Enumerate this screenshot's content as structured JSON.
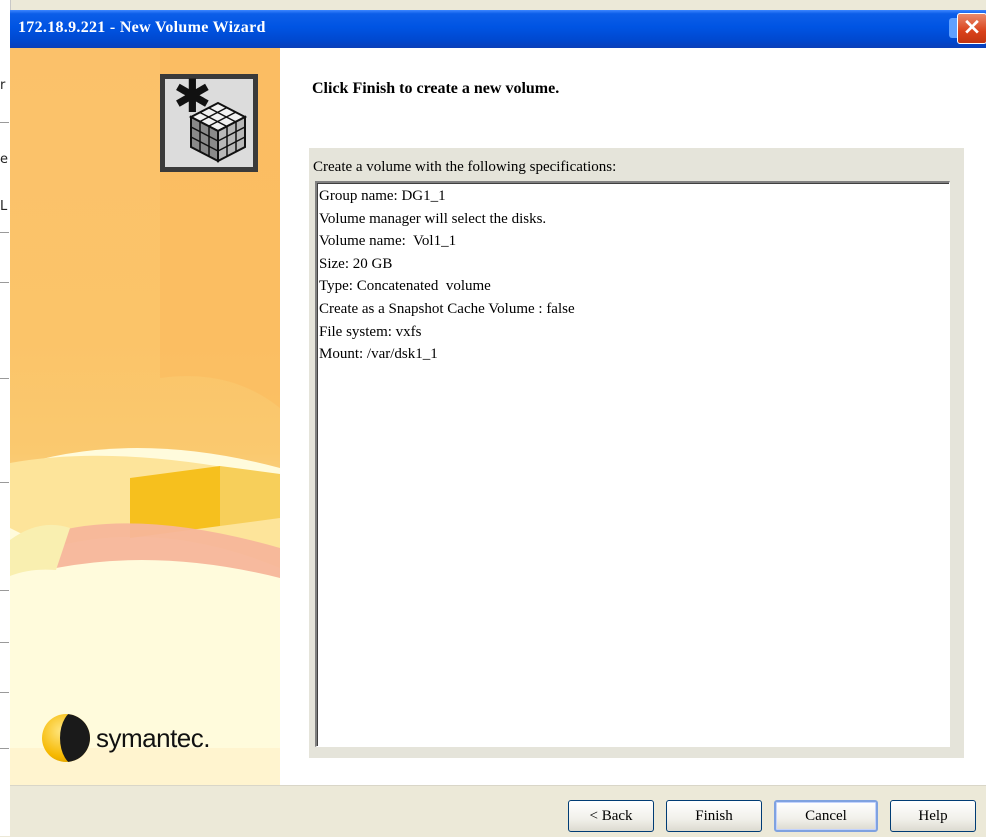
{
  "window": {
    "title": "172.18.9.221 - New Volume Wizard",
    "close_glyph": "×"
  },
  "left_edge_glyphs": [
    "r",
    "e",
    "L"
  ],
  "sidebar": {
    "icon": "new-volume-wizard-icon",
    "logo_text": "symantec."
  },
  "content": {
    "headline": "Click Finish to create a new volume.",
    "spec_caption": "Create a volume with the following specifications:",
    "spec_lines": [
      "Group name: DG1_1",
      "Volume manager will select the disks.",
      "Volume name:  Vol1_1",
      "Size: 20 GB",
      "Type: Concatenated  volume",
      "Create as a Snapshot Cache Volume : false",
      "File system: vxfs",
      "Mount: /var/dsk1_1"
    ]
  },
  "buttons": {
    "back": "< Back",
    "finish": "Finish",
    "cancel": "Cancel",
    "help": "Help"
  },
  "colors": {
    "titlebar": "#0054e3",
    "close": "#d9411a",
    "sidebar_orange": "#fbc16a",
    "panel": "#e5e4da"
  }
}
